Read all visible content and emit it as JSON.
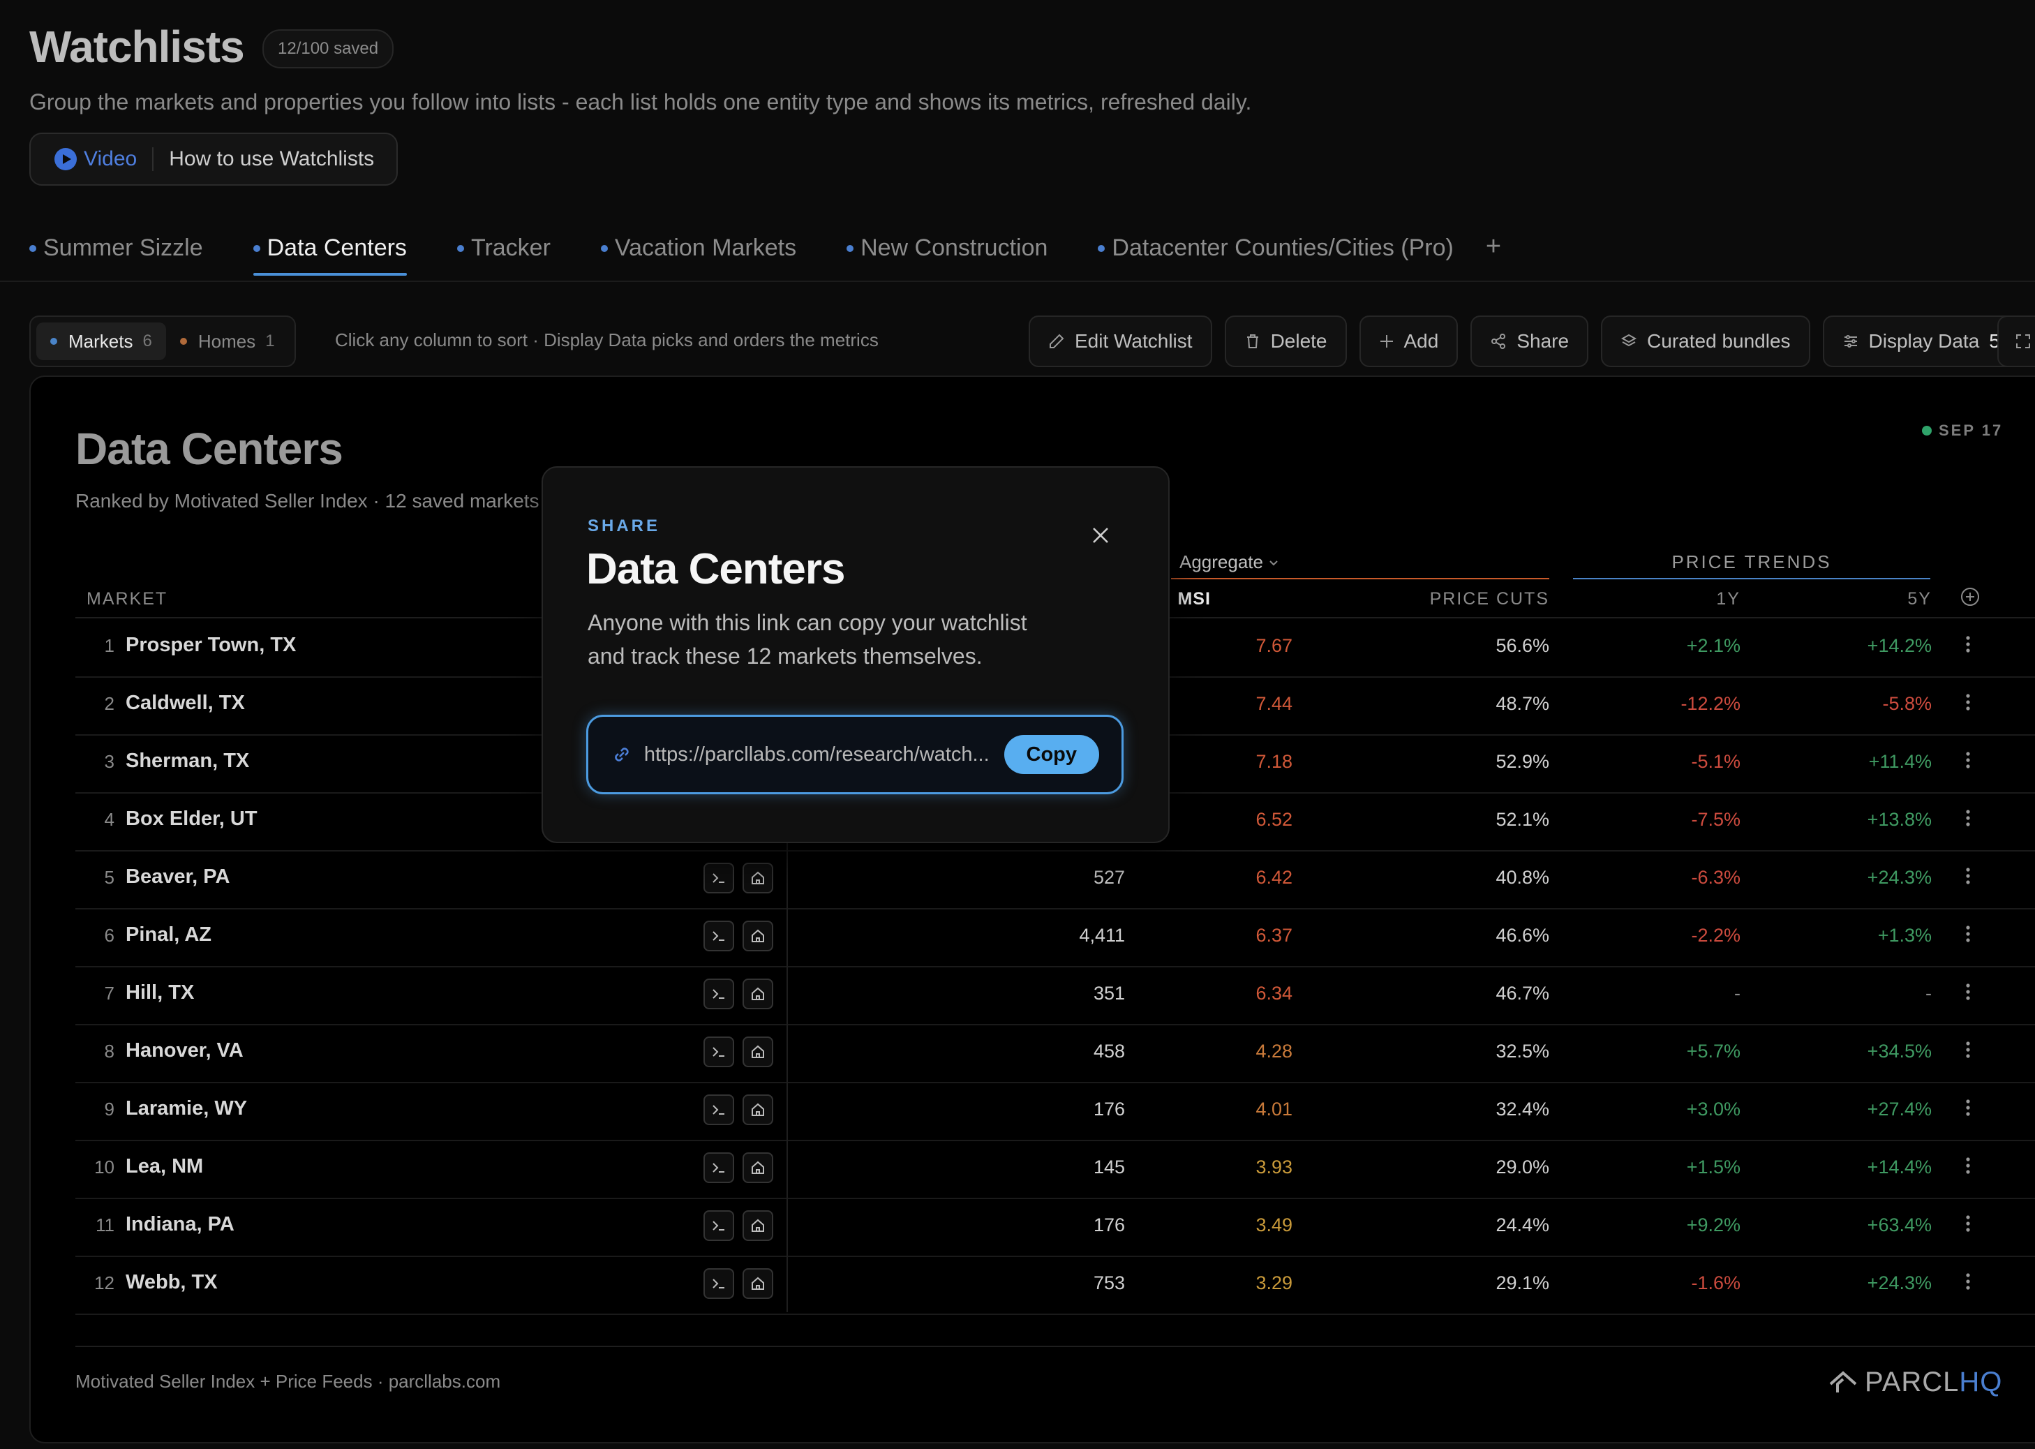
{
  "header": {
    "title": "Watchlists",
    "saved_badge": "12/100 saved",
    "subtitle": "Group the markets and properties you follow into lists - each list holds one entity type and shows its metrics, refreshed daily.",
    "video_label": "Video",
    "video_link": "How to use Watchlists"
  },
  "tabs": [
    {
      "label": "Summer Sizzle",
      "active": false
    },
    {
      "label": "Data Centers",
      "active": true
    },
    {
      "label": "Tracker",
      "active": false
    },
    {
      "label": "Vacation Markets",
      "active": false
    },
    {
      "label": "New Construction",
      "active": false
    },
    {
      "label": "Datacenter Counties/Cities (Pro)",
      "active": false
    }
  ],
  "tab_add": "+",
  "toolbar": {
    "segments": [
      {
        "label": "Markets",
        "count": "6",
        "dot_color": "#4a84c8",
        "active": true
      },
      {
        "label": "Homes",
        "count": "1",
        "dot_color": "#b06a3a",
        "active": false
      }
    ],
    "hint": "Click any column to sort · Display Data picks and orders the metrics",
    "edit": "Edit Watchlist",
    "delete": "Delete",
    "add": "Add",
    "share": "Share",
    "bundles": "Curated bundles",
    "display_data": "Display Data",
    "display_count": "5"
  },
  "card": {
    "title": "Data Centers",
    "subtitle": "Ranked by Motivated Seller Index · 12 saved markets",
    "date": "SEP 17",
    "group_aggregate": "Aggregate",
    "group_trends": "PRICE TRENDS",
    "col_market": "MARKET",
    "col_msi": "↓ MSI",
    "col_cuts": "PRICE CUTS",
    "col_1y": "1Y",
    "col_5y": "5Y",
    "footer": "Motivated Seller Index + Price Feeds · parcllabs.com",
    "brand_main": "PARCL",
    "brand_accent": "HQ"
  },
  "rows": [
    {
      "rank": "1",
      "market": "Prosper Town, TX",
      "units": "",
      "msi": "7.67",
      "cuts": "56.6%",
      "y1": "+2.1%",
      "y5": "+14.2%"
    },
    {
      "rank": "2",
      "market": "Caldwell, TX",
      "units": "",
      "msi": "7.44",
      "cuts": "48.7%",
      "y1": "-12.2%",
      "y5": "-5.8%"
    },
    {
      "rank": "3",
      "market": "Sherman, TX",
      "units": "",
      "msi": "7.18",
      "cuts": "52.9%",
      "y1": "-5.1%",
      "y5": "+11.4%"
    },
    {
      "rank": "4",
      "market": "Box Elder, UT",
      "units": "",
      "msi": "6.52",
      "cuts": "52.1%",
      "y1": "-7.5%",
      "y5": "+13.8%"
    },
    {
      "rank": "5",
      "market": "Beaver, PA",
      "units": "527",
      "msi": "6.42",
      "cuts": "40.8%",
      "y1": "-6.3%",
      "y5": "+24.3%"
    },
    {
      "rank": "6",
      "market": "Pinal, AZ",
      "units": "4,411",
      "msi": "6.37",
      "cuts": "46.6%",
      "y1": "-2.2%",
      "y5": "+1.3%"
    },
    {
      "rank": "7",
      "market": "Hill, TX",
      "units": "351",
      "msi": "6.34",
      "cuts": "46.7%",
      "y1": "-",
      "y5": "-"
    },
    {
      "rank": "8",
      "market": "Hanover, VA",
      "units": "458",
      "msi": "4.28",
      "cuts": "32.5%",
      "y1": "+5.7%",
      "y5": "+34.5%"
    },
    {
      "rank": "9",
      "market": "Laramie, WY",
      "units": "176",
      "msi": "4.01",
      "cuts": "32.4%",
      "y1": "+3.0%",
      "y5": "+27.4%"
    },
    {
      "rank": "10",
      "market": "Lea, NM",
      "units": "145",
      "msi": "3.93",
      "cuts": "29.0%",
      "y1": "+1.5%",
      "y5": "+14.4%"
    },
    {
      "rank": "11",
      "market": "Indiana, PA",
      "units": "176",
      "msi": "3.49",
      "cuts": "24.4%",
      "y1": "+9.2%",
      "y5": "+63.4%"
    },
    {
      "rank": "12",
      "market": "Webb, TX",
      "units": "753",
      "msi": "3.29",
      "cuts": "29.1%",
      "y1": "-1.6%",
      "y5": "+24.3%"
    }
  ],
  "modal": {
    "eyebrow": "SHARE",
    "title": "Data Centers",
    "description": "Anyone with this link can copy your watchlist and track these 12 markets themselves.",
    "url": "https://parcllabs.com/research/watch...",
    "copy_label": "Copy"
  }
}
